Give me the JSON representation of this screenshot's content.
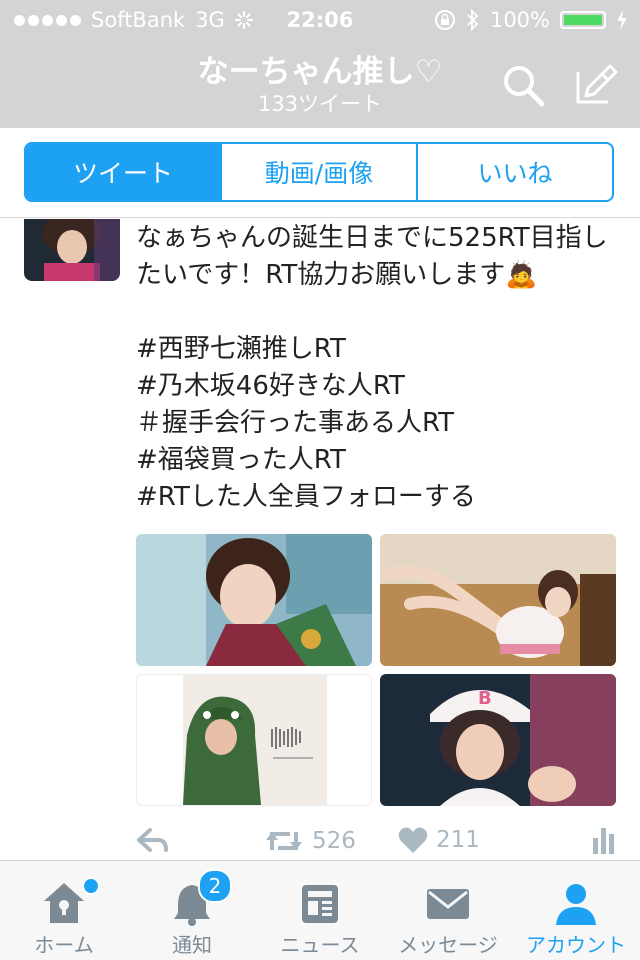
{
  "status_bar": {
    "carrier": "SoftBank",
    "network": "3G",
    "time": "22:06",
    "battery": "100%"
  },
  "nav": {
    "title": "なーちゃん推し♡",
    "subtitle": "133ツイート"
  },
  "segments": {
    "tweets": "ツイート",
    "media": "動画/画像",
    "likes": "いいね"
  },
  "tweet": {
    "text": "なぁちゃんの誕生日までに525RT目指したいです！RT協力お願いします🙇\n\n#西野七瀬推しRT\n#乃木坂46好きな人RT\n＃握手会行った事ある人RT\n#福袋買った人RT\n#RTした人全員フォローする",
    "retweets": "526",
    "likes": "211"
  },
  "tabbar": {
    "home": "ホーム",
    "notifications": "通知",
    "notifications_badge": "2",
    "news": "ニュース",
    "messages": "メッセージ",
    "account": "アカウント"
  },
  "colors": {
    "accent": "#1da1f2",
    "header_bg": "#d4d4d6",
    "action_gray": "#aab8c2",
    "tab_gray": "#7c8a96"
  }
}
